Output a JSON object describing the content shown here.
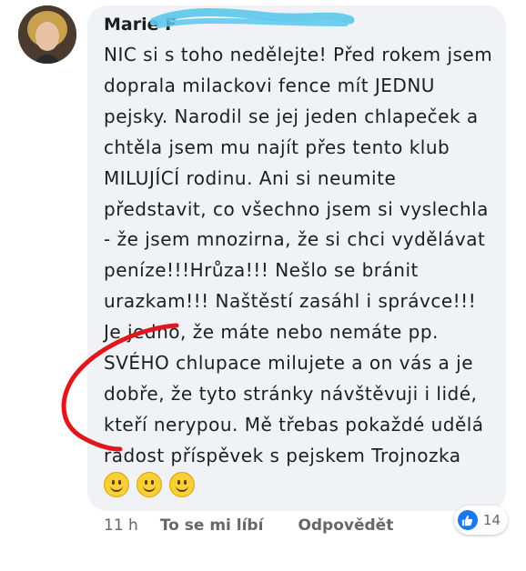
{
  "comment": {
    "author": "Marie F",
    "paragraph1": "NIC si s toho nedělejte! Před rokem jsem doprala milackovi fence mít JEDNU pejsky. Narodil se jej jeden chlapeček a chtěla jsem mu najít přes tento klub MILUJÍCÍ rodinu. Ani si neumite představit, co všechno jsem si vyslechla  - že jsem mnozirna, že si chci vydělávat peníze!!!Hrůza!!! Nešlo se bránit urazkam!!! Naštěstí zasáhl i správce!!!",
    "paragraph2": "Je jedno, že máte nebo nemáte pp. SVÉHO chlupace milujete a on vás a je dobře, že tyto stránky návštěvuji i lidé, kteří nerypou. Mě třebas pokaždé udělá radost příspěvek s pejskem Trojnozka"
  },
  "actions": {
    "time": "11 h",
    "like": "To se mi líbí",
    "reply": "Odpovědět"
  },
  "reactions": {
    "icon": "like-thumb-icon",
    "count": "14"
  },
  "colors": {
    "bubble": "#f0f2f5",
    "like_blue": "#1877f2",
    "scribble_blue": "#5bc8ec",
    "annotation_red": "#e0181d"
  }
}
